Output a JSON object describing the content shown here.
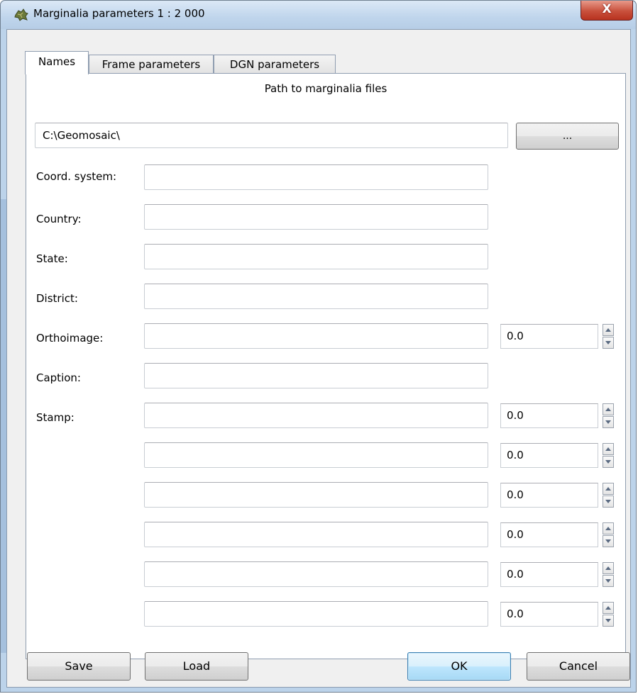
{
  "window": {
    "title": "Marginalia parameters 1 : 2 000",
    "close_glyph": "X"
  },
  "tabs": [
    {
      "label": "Names",
      "active": true
    },
    {
      "label": "Frame parameters",
      "active": false
    },
    {
      "label": "DGN parameters",
      "active": false
    }
  ],
  "names_panel": {
    "heading": "Path to marginalia files",
    "path_value": "C:\\Geomosaic\\",
    "browse_label": "...",
    "labels": {
      "coord_system": "Coord. system:",
      "country": "Country:",
      "state": "State:",
      "district": "District:",
      "orthoimage": "Orthoimage:",
      "caption": "Caption:",
      "stamp": "Stamp:"
    },
    "values": {
      "coord_system": "",
      "country": "",
      "state": "",
      "district": "",
      "orthoimage": "",
      "caption": ""
    },
    "orthoimage_number": "0.0",
    "stamp_rows": [
      {
        "text": "",
        "number": "0.0"
      },
      {
        "text": "",
        "number": "0.0"
      },
      {
        "text": "",
        "number": "0.0"
      },
      {
        "text": "",
        "number": "0.0"
      },
      {
        "text": "",
        "number": "0.0"
      },
      {
        "text": "",
        "number": "0.0"
      }
    ]
  },
  "buttons": {
    "save": "Save",
    "load": "Load",
    "ok": "OK",
    "cancel": "Cancel"
  },
  "icons": {
    "app": "map-leaf-icon",
    "close": "close-icon",
    "spin_up": "spin-up-icon",
    "spin_down": "spin-down-icon"
  },
  "colors": {
    "titlebar": "#bfd5ec",
    "close": "#c8503c",
    "ok_accent": "#3c7fb1"
  }
}
